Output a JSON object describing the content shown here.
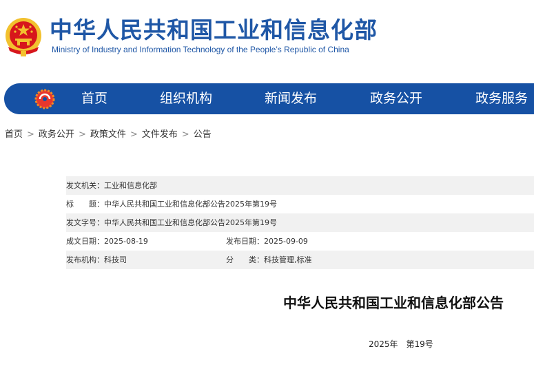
{
  "header": {
    "title": "中华人民共和国工业和信息化部",
    "subtitle": "Ministry of Industry and Information Technology of the People’s Republic of China",
    "emblem_icon": "national-emblem-icon",
    "colors": {
      "brand_blue": "#1f57a6",
      "nav_blue": "#1651a4",
      "emblem_red": "#d7161c",
      "emblem_gold": "#f2c12e"
    }
  },
  "nav": {
    "logo_icon": "ministry-logo-icon",
    "items": [
      {
        "label": "首页"
      },
      {
        "label": "组织机构"
      },
      {
        "label": "新闻发布"
      },
      {
        "label": "政务公开"
      },
      {
        "label": "政务服务"
      }
    ]
  },
  "breadcrumb": {
    "items": [
      "首页",
      "政务公开",
      "政策文件",
      "文件发布",
      "公告"
    ],
    "separator": ">"
  },
  "info": {
    "issuer_label": "发文机关：",
    "issuer_value": "工业和信息化部",
    "title_label": "标　　题：",
    "title_value": "中华人民共和国工业和信息化部公告2025年第19号",
    "doc_no_label": "发文字号：",
    "doc_no_value": "中华人民共和国工业和信息化部公告2025年第19号",
    "created_label": "成文日期：",
    "created_value": "2025-08-19",
    "published_label": "发布日期：",
    "published_value": "2025-09-09",
    "org_label": "发布机构：",
    "org_value": "科技司",
    "category_label": "分　　类：",
    "category_value": "科技管理,标准"
  },
  "document": {
    "title": "中华人民共和国工业和信息化部公告",
    "number": "2025年　第19号"
  }
}
